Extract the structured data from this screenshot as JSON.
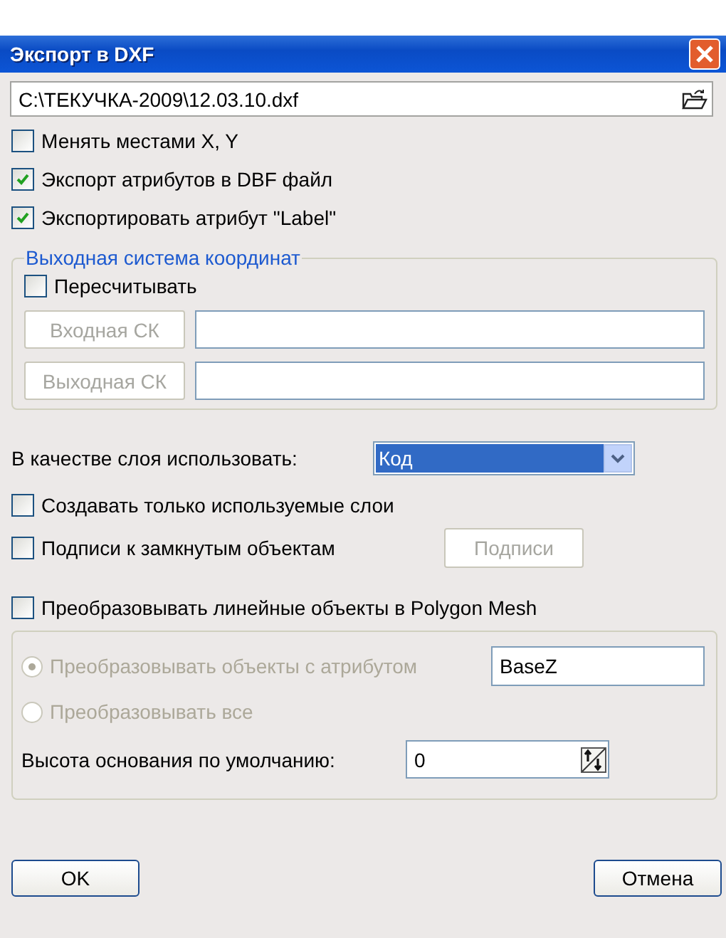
{
  "window": {
    "title": "Экспорт в DXF"
  },
  "file_path": {
    "value": "C:\\ТЕКУЧКА-2009\\12.03.10.dxf"
  },
  "options": [
    {
      "label": "Менять местами X, Y",
      "checked": false
    },
    {
      "label": "Экспорт атрибутов в DBF файл",
      "checked": true
    },
    {
      "label": "Экспортировать атрибут \"Label\"",
      "checked": true
    }
  ],
  "coordinate_group": {
    "title": "Выходная система координат",
    "recalculate": {
      "label": "Пересчитывать",
      "checked": false
    },
    "rows": [
      {
        "button": "Входная СК",
        "disabled": true
      },
      {
        "button": "Выходная СК",
        "disabled": true
      }
    ]
  },
  "layer": {
    "label": "В качестве слоя использовать:",
    "value": "Код"
  },
  "only_used_layers": {
    "label": "Создавать только используемые слои",
    "checked": false
  },
  "closed_labels": {
    "label": "Подписи к замкнутым объектам",
    "checked": false,
    "button": "Подписи",
    "button_disabled": true
  },
  "polygon_mesh": {
    "label": "Преобразовывать линейные объекты в Polygon Mesh",
    "checked": false
  },
  "mesh_group": {
    "radios": [
      {
        "label": "Преобразовывать объекты с атрибутом",
        "selected": true,
        "disabled": true,
        "value": "BaseZ"
      },
      {
        "label": "Преобразовывать все",
        "selected": false,
        "disabled": true
      }
    ],
    "height": {
      "label": "Высота основания по умолчанию:",
      "value": "0"
    }
  },
  "buttons": [
    {
      "label": "OK"
    },
    {
      "label": "Отмена"
    }
  ]
}
